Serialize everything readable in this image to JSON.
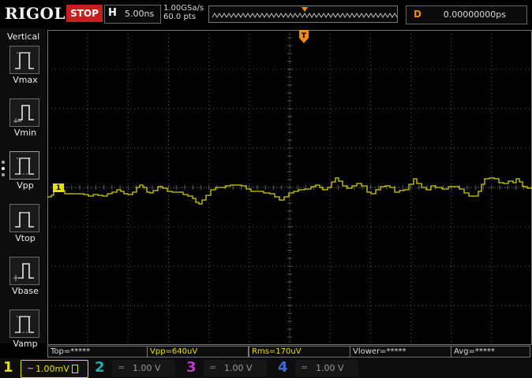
{
  "brand": "RIGOL",
  "run_state": "STOP",
  "timebase": {
    "label": "H",
    "value": "5.00ns"
  },
  "sampling": {
    "rate": "1.00GSa/s",
    "points": "60.0 pts"
  },
  "trigger_marker_label": "T",
  "delay": {
    "label": "D",
    "value": "0.00000000ps"
  },
  "menu": {
    "title": "Vertical",
    "items": [
      {
        "label": "Vmax",
        "icon": "vmax-icon"
      },
      {
        "label": "Vmin",
        "icon": "vmin-icon"
      },
      {
        "label": "Vpp",
        "icon": "vpp-icon"
      },
      {
        "label": "Vtop",
        "icon": "vtop-icon"
      },
      {
        "label": "Vbase",
        "icon": "vbase-icon"
      },
      {
        "label": "Vamp",
        "icon": "vamp-icon"
      }
    ]
  },
  "channel1_marker": "1",
  "measurements": [
    {
      "text": "Top=*****"
    },
    {
      "text": "Vpp=640uV"
    },
    {
      "text": "Rms=170uV"
    },
    {
      "text": "Vlower=*****"
    },
    {
      "text": "Avg=*****"
    }
  ],
  "channels": [
    {
      "num": "1",
      "coupling": "~",
      "value": "1.00mV",
      "color": "#e8e000",
      "active": true
    },
    {
      "num": "2",
      "coupling": "=",
      "value": "1.00 V",
      "color": "#1ab3b3",
      "active": false
    },
    {
      "num": "3",
      "coupling": "=",
      "value": "1.00 V",
      "color": "#c03ad0",
      "active": false
    },
    {
      "num": "4",
      "coupling": "=",
      "value": "1.00 V",
      "color": "#3a6fe0",
      "active": false
    }
  ],
  "colors": {
    "trace": "#d4d000",
    "grid": "#5a5a5a",
    "trigger": "#f08a1c",
    "stop": "#c81e1e"
  }
}
